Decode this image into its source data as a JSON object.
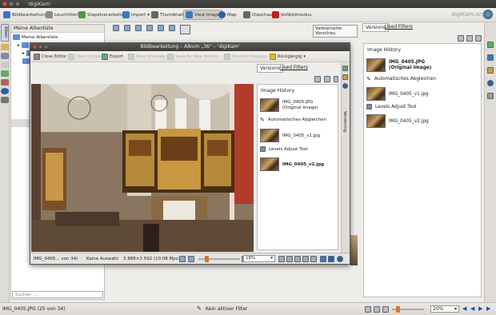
{
  "window": {
    "title": "'digiKam'"
  },
  "toolbar": {
    "items": [
      {
        "label": "Bildbearbeitung",
        "icon": "image-editor-icon",
        "color": "#3a78c8"
      },
      {
        "label": "Leuchttisch",
        "icon": "lighttable-icon",
        "color": "#8a8a8a"
      },
      {
        "label": "Stapelverarbeitung",
        "icon": "batch-queue-icon",
        "color": "#4a9a4a"
      },
      {
        "label": "Import",
        "icon": "import-icon",
        "color": "#3a78c8"
      },
      {
        "label": "Thumbnails",
        "icon": "thumbnails-icon",
        "color": "#666"
      },
      {
        "label": "View Image",
        "icon": "view-image-icon",
        "color": "#3a78c8"
      },
      {
        "label": "Map",
        "icon": "map-icon",
        "color": "#2a5fa8"
      },
      {
        "label": "Diaschau",
        "icon": "slideshow-icon",
        "color": "#666"
      },
      {
        "label": "Vollbildmodus",
        "icon": "fullscreen-icon",
        "color": "#c02020"
      }
    ],
    "brand": "digiKam.org"
  },
  "left_tabs": [
    "Alben"
  ],
  "albums": {
    "header": "Meine Albenliste",
    "root": "Meine Albenliste",
    "search_placeholder": "Suchen ..."
  },
  "center": {
    "preview_button": "Verkleinerte Vorschau"
  },
  "right_panel": {
    "tabs": [
      "Versions",
      "Used Filters"
    ],
    "section_title": "Image History",
    "entries": [
      {
        "kind": "image",
        "name": "IMG_0405.JPG",
        "sub": "(Original Image)",
        "bold": true
      },
      {
        "kind": "filter",
        "name": "Automatisches Abgleichen"
      },
      {
        "kind": "image",
        "name": "IMG_0405_v1.jpg"
      },
      {
        "kind": "filter",
        "name": "Levels Adjust Tool"
      },
      {
        "kind": "image",
        "name": "IMG_0405_v2.jpg"
      }
    ]
  },
  "editor": {
    "title": "Bildbearbeitung – Album „36“ – 'digiKam'",
    "toolbar": [
      {
        "label": "Close Editor",
        "disabled": false
      },
      {
        "label": "Open Original",
        "disabled": true
      },
      {
        "label": "Export",
        "disabled": false
      },
      {
        "label": "Save Changes",
        "disabled": true
      },
      {
        "label": "Save As New Version",
        "disabled": true
      },
      {
        "label": "Discard Changes",
        "disabled": true
      },
      {
        "label": "Rückgängig",
        "disabled": false
      }
    ],
    "tabs": [
      "Versions",
      "Used Filters"
    ],
    "section_title": "Image History",
    "entries": [
      {
        "kind": "image",
        "name": "IMG_0405.JPG",
        "sub": "(Original Image)",
        "bold": false
      },
      {
        "kind": "filter",
        "name": "Automatisches Abgleichen"
      },
      {
        "kind": "image",
        "name": "IMG_0405_v1.jpg"
      },
      {
        "kind": "filter",
        "name": "Levels Adjust Tool"
      },
      {
        "kind": "image",
        "name": "IMG_0405_v2.jpg",
        "bold": true
      }
    ],
    "status": {
      "file": "IMG_0405... von 34)",
      "selection": "Keine Auswahl",
      "dimensions": "3 888×2 592 (10.08 Mpx)",
      "zoom": "18%"
    },
    "side_tab": "Versioning"
  },
  "statusbar": {
    "file": "IMG_0405.JPG (25 von 34)",
    "filter": "Kein aktiver Filter",
    "zoom": "20%"
  }
}
